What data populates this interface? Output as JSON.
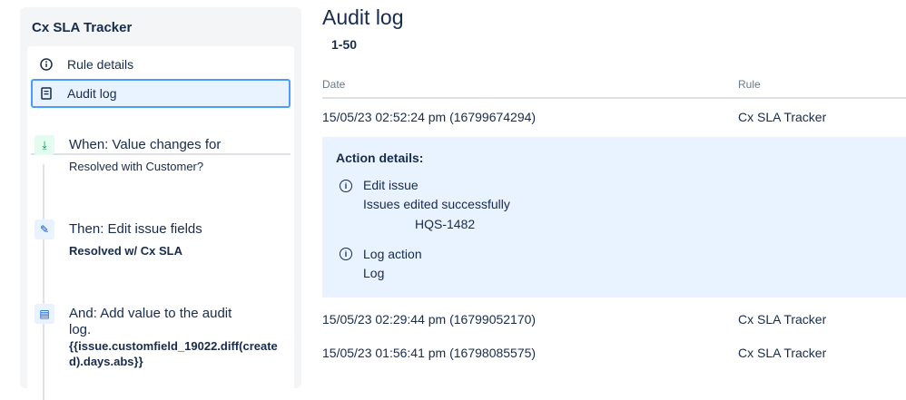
{
  "sidebar": {
    "title": "Cx SLA Tracker",
    "nav": [
      {
        "label": "Rule details"
      },
      {
        "label": "Audit log"
      }
    ],
    "steps": [
      {
        "title": "When: Value changes for",
        "detail": "Resolved with Customer?"
      },
      {
        "title": "Then: Edit issue fields",
        "detail": "Resolved w/ Cx SLA"
      },
      {
        "title": "And: Add value to the audit log.",
        "detail": "{{issue.customfield_19022.diff(created).days.abs}}"
      }
    ]
  },
  "main": {
    "title": "Audit log",
    "range": "1-50",
    "columns": [
      "Date",
      "Rule"
    ],
    "rows": [
      {
        "date": "15/05/23 02:52:24 pm (16799674294)",
        "rule": "Cx SLA Tracker"
      },
      {
        "date": "15/05/23 02:29:44 pm (16799052170)",
        "rule": "Cx SLA Tracker"
      },
      {
        "date": "15/05/23 01:56:41 pm (16798085575)",
        "rule": "Cx SLA Tracker"
      }
    ],
    "details": {
      "heading": "Action details:",
      "actions": [
        {
          "name": "Edit issue",
          "message": "Issues edited successfully",
          "item": "HQS-1482"
        },
        {
          "name": "Log action",
          "message": "Log"
        }
      ]
    }
  }
}
